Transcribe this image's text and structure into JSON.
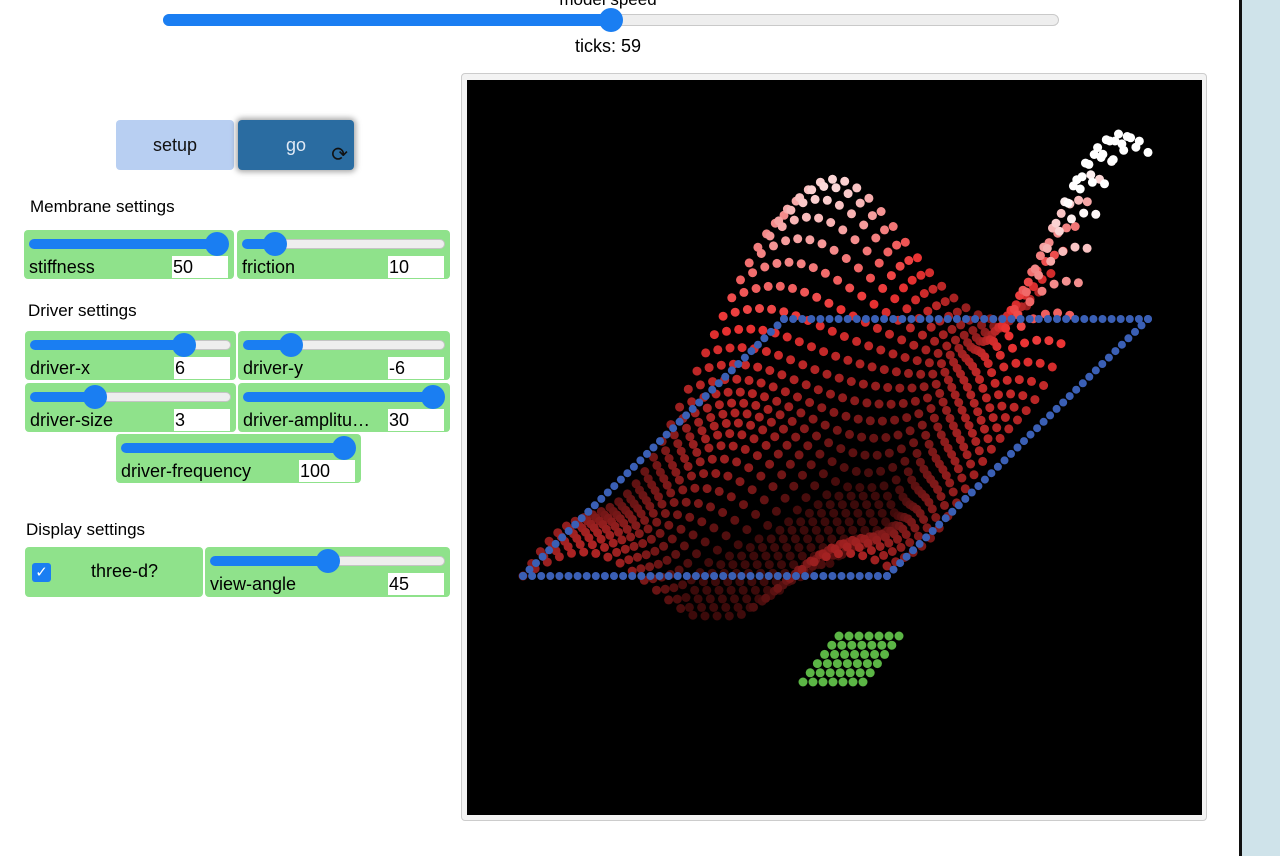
{
  "model_speed": {
    "label": "model speed",
    "level": 0.5
  },
  "ticks_label": "ticks: 59",
  "buttons": {
    "setup": "setup",
    "go": "go",
    "go_icon": "⟳"
  },
  "sections": {
    "membrane": "Membrane settings",
    "driver": "Driver settings",
    "display": "Display settings"
  },
  "sliders": {
    "stiffness": {
      "name": "stiffness",
      "value": "50",
      "level": 1.0
    },
    "friction": {
      "name": "friction",
      "value": "10",
      "level": 0.12
    },
    "driver_x": {
      "name": "driver-x",
      "value": "6",
      "level": 0.8
    },
    "driver_y": {
      "name": "driver-y",
      "value": "-6",
      "level": 0.2
    },
    "driver_size": {
      "name": "driver-size",
      "value": "3",
      "level": 0.3
    },
    "driver_amplitude": {
      "name": "driver-amplitu…",
      "value": "30",
      "level": 1.0
    },
    "driver_frequency": {
      "name": "driver-frequency",
      "value": "100",
      "level": 1.0
    },
    "view_angle": {
      "name": "view-angle",
      "value": "45",
      "level": 0.5
    }
  },
  "switch": {
    "label": "three-d?",
    "checked": true,
    "check_glyph": "✓"
  },
  "colors": {
    "slider_blue": "#1a7ef2",
    "widget_green": "#8fe28b",
    "go_button": "#2a6ca1",
    "setup_button": "#b8cff2",
    "plane_edge_blue": "#3a5fb5",
    "driver_green": "#5bb545",
    "membrane_red": "#e03a3a",
    "side_panel": "#cfe3ea"
  },
  "icons": {
    "go": "refresh-icon",
    "checkbox": "check-icon"
  }
}
